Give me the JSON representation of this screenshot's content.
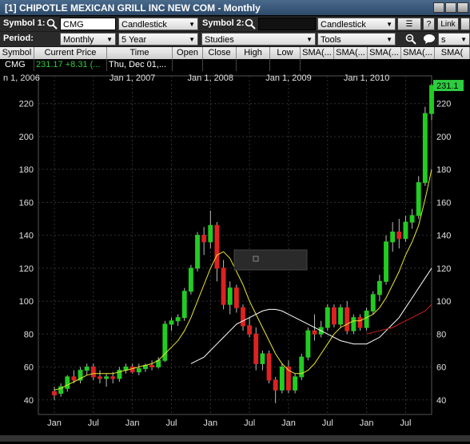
{
  "window": {
    "title": "[1] CHIPOTLE MEXICAN GRILL INC NEW COM - Monthly"
  },
  "toolbar1": {
    "symbol1_label": "Symbol 1:",
    "symbol1_value": "CMG",
    "chart_type1": "Candlestick",
    "symbol2_label": "Symbol 2:",
    "symbol2_value": "",
    "chart_type2": "Candlestick",
    "help_label": "?",
    "link_label": "Link"
  },
  "toolbar2": {
    "period_label": "Period:",
    "period_value": "Monthly",
    "range_value": "5 Year",
    "studies_value": "Studies",
    "tools_value": "Tools",
    "extra_value": "s"
  },
  "table": {
    "headers": [
      "Symbol",
      "Current Price",
      "Time",
      "Open",
      "Close",
      "High",
      "Low",
      "SMA(...",
      "SMA(...",
      "SMA(...",
      "SMA(...",
      "SMA("
    ],
    "row": {
      "symbol": "CMG",
      "price": "231.17",
      "change": "+8.31 (...",
      "time": "Thu, Dec 01,..."
    }
  },
  "chart_data": {
    "type": "candlestick",
    "x_top_labels": [
      "n 1, 2006",
      "Jan 1, 2007",
      "Jan 1, 2008",
      "Jan 1, 2009",
      "Jan 1, 2010"
    ],
    "x_bottom_labels": [
      "Jan",
      "Jul",
      "Jan",
      "Jul",
      "Jan",
      "Jul",
      "Jan",
      "Jul",
      "Jan",
      "Jul"
    ],
    "y_ticks": [
      40,
      60,
      80,
      100,
      120,
      140,
      160,
      180,
      200,
      220
    ],
    "ylim": [
      36,
      232
    ],
    "last_price_tag": "231.1",
    "colors": {
      "up": "#22cc22",
      "down": "#dd2222",
      "sma_short": "#e8e830",
      "sma_mid": "#ffffff",
      "sma_long": "#cc2222",
      "grid": "#333333",
      "axis_text": "#e0e0e0"
    },
    "candles": [
      {
        "o": 45,
        "h": 48,
        "l": 40,
        "c": 43
      },
      {
        "o": 44,
        "h": 50,
        "l": 42,
        "c": 48
      },
      {
        "o": 47,
        "h": 55,
        "l": 45,
        "c": 54
      },
      {
        "o": 54,
        "h": 58,
        "l": 50,
        "c": 52
      },
      {
        "o": 52,
        "h": 60,
        "l": 50,
        "c": 58
      },
      {
        "o": 58,
        "h": 62,
        "l": 55,
        "c": 60
      },
      {
        "o": 60,
        "h": 62,
        "l": 52,
        "c": 54
      },
      {
        "o": 54,
        "h": 58,
        "l": 50,
        "c": 53
      },
      {
        "o": 53,
        "h": 56,
        "l": 48,
        "c": 54
      },
      {
        "o": 54,
        "h": 57,
        "l": 50,
        "c": 53
      },
      {
        "o": 53,
        "h": 60,
        "l": 51,
        "c": 58
      },
      {
        "o": 58,
        "h": 62,
        "l": 56,
        "c": 60
      },
      {
        "o": 60,
        "h": 62,
        "l": 56,
        "c": 57
      },
      {
        "o": 57,
        "h": 62,
        "l": 55,
        "c": 59
      },
      {
        "o": 59,
        "h": 62,
        "l": 57,
        "c": 61
      },
      {
        "o": 61,
        "h": 64,
        "l": 58,
        "c": 60
      },
      {
        "o": 60,
        "h": 66,
        "l": 59,
        "c": 64
      },
      {
        "o": 64,
        "h": 88,
        "l": 63,
        "c": 86
      },
      {
        "o": 86,
        "h": 90,
        "l": 82,
        "c": 88
      },
      {
        "o": 88,
        "h": 92,
        "l": 85,
        "c": 90
      },
      {
        "o": 90,
        "h": 108,
        "l": 88,
        "c": 106
      },
      {
        "o": 106,
        "h": 122,
        "l": 104,
        "c": 120
      },
      {
        "o": 120,
        "h": 142,
        "l": 118,
        "c": 140
      },
      {
        "o": 140,
        "h": 145,
        "l": 128,
        "c": 136
      },
      {
        "o": 136,
        "h": 155,
        "l": 132,
        "c": 146
      },
      {
        "o": 146,
        "h": 148,
        "l": 112,
        "c": 120
      },
      {
        "o": 120,
        "h": 125,
        "l": 95,
        "c": 98
      },
      {
        "o": 98,
        "h": 112,
        "l": 92,
        "c": 108
      },
      {
        "o": 108,
        "h": 110,
        "l": 93,
        "c": 96
      },
      {
        "o": 96,
        "h": 98,
        "l": 82,
        "c": 85
      },
      {
        "o": 85,
        "h": 90,
        "l": 78,
        "c": 80
      },
      {
        "o": 80,
        "h": 84,
        "l": 58,
        "c": 62
      },
      {
        "o": 62,
        "h": 70,
        "l": 58,
        "c": 68
      },
      {
        "o": 68,
        "h": 70,
        "l": 50,
        "c": 52
      },
      {
        "o": 52,
        "h": 54,
        "l": 38,
        "c": 46
      },
      {
        "o": 46,
        "h": 62,
        "l": 44,
        "c": 60
      },
      {
        "o": 60,
        "h": 64,
        "l": 44,
        "c": 46
      },
      {
        "o": 46,
        "h": 56,
        "l": 44,
        "c": 54
      },
      {
        "o": 54,
        "h": 68,
        "l": 52,
        "c": 66
      },
      {
        "o": 66,
        "h": 84,
        "l": 64,
        "c": 82
      },
      {
        "o": 82,
        "h": 92,
        "l": 76,
        "c": 80
      },
      {
        "o": 80,
        "h": 88,
        "l": 78,
        "c": 84
      },
      {
        "o": 84,
        "h": 98,
        "l": 82,
        "c": 96
      },
      {
        "o": 96,
        "h": 98,
        "l": 84,
        "c": 86
      },
      {
        "o": 86,
        "h": 98,
        "l": 84,
        "c": 96
      },
      {
        "o": 96,
        "h": 100,
        "l": 80,
        "c": 82
      },
      {
        "o": 82,
        "h": 92,
        "l": 80,
        "c": 90
      },
      {
        "o": 90,
        "h": 92,
        "l": 82,
        "c": 84
      },
      {
        "o": 84,
        "h": 96,
        "l": 82,
        "c": 94
      },
      {
        "o": 94,
        "h": 106,
        "l": 92,
        "c": 104
      },
      {
        "o": 104,
        "h": 116,
        "l": 100,
        "c": 112
      },
      {
        "o": 112,
        "h": 140,
        "l": 110,
        "c": 136
      },
      {
        "o": 136,
        "h": 148,
        "l": 130,
        "c": 142
      },
      {
        "o": 142,
        "h": 150,
        "l": 132,
        "c": 138
      },
      {
        "o": 138,
        "h": 152,
        "l": 136,
        "c": 148
      },
      {
        "o": 148,
        "h": 156,
        "l": 144,
        "c": 152
      },
      {
        "o": 152,
        "h": 176,
        "l": 150,
        "c": 172
      },
      {
        "o": 172,
        "h": 218,
        "l": 170,
        "c": 214
      },
      {
        "o": 214,
        "h": 232,
        "l": 210,
        "c": 231
      }
    ],
    "sma_short": [
      46,
      47,
      49,
      51,
      53,
      55,
      56,
      56,
      56,
      56,
      57,
      58,
      59,
      60,
      61,
      62,
      64,
      68,
      72,
      76,
      82,
      90,
      100,
      110,
      120,
      128,
      130,
      126,
      118,
      110,
      100,
      92,
      84,
      76,
      68,
      62,
      58,
      56,
      56,
      58,
      62,
      68,
      74,
      80,
      84,
      86,
      88,
      88,
      90,
      92,
      96,
      102,
      110,
      118,
      128,
      136,
      146,
      162,
      180
    ],
    "sma_mid": [
      null,
      null,
      null,
      null,
      null,
      null,
      null,
      null,
      null,
      null,
      null,
      null,
      null,
      null,
      null,
      null,
      null,
      null,
      null,
      null,
      null,
      62,
      64,
      66,
      70,
      74,
      78,
      82,
      86,
      88,
      90,
      92,
      94,
      95,
      95,
      94,
      92,
      90,
      88,
      86,
      84,
      82,
      80,
      78,
      76,
      75,
      74,
      74,
      74,
      76,
      78,
      82,
      86,
      90,
      96,
      102,
      108,
      114,
      120
    ],
    "sma_long": [
      null,
      null,
      null,
      null,
      null,
      null,
      null,
      null,
      null,
      null,
      null,
      null,
      null,
      null,
      null,
      null,
      null,
      null,
      null,
      null,
      null,
      null,
      null,
      null,
      null,
      null,
      null,
      null,
      null,
      null,
      null,
      null,
      null,
      null,
      null,
      null,
      null,
      null,
      null,
      null,
      null,
      null,
      null,
      null,
      null,
      null,
      null,
      null,
      80,
      81,
      82,
      83,
      84,
      86,
      88,
      90,
      92,
      94,
      98
    ]
  }
}
